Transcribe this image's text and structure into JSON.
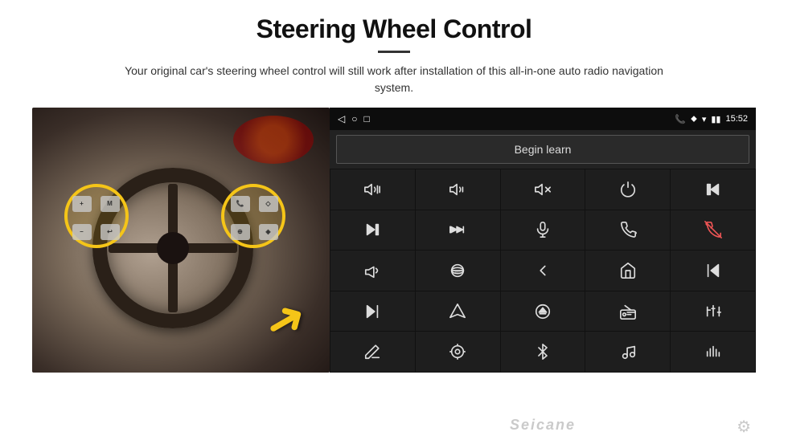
{
  "header": {
    "title": "Steering Wheel Control",
    "divider": true,
    "subtitle": "Your original car's steering wheel control will still work after installation of this all-in-one auto radio navigation system."
  },
  "status_bar": {
    "left_icons": [
      "◁",
      "○",
      "□"
    ],
    "right_icons": [
      "📞",
      "📍",
      "📶"
    ],
    "time": "15:52"
  },
  "begin_learn": {
    "label": "Begin learn"
  },
  "grid": {
    "cells": [
      {
        "icon": "vol-up",
        "label": "Volume Up"
      },
      {
        "icon": "vol-down",
        "label": "Volume Down"
      },
      {
        "icon": "vol-mute",
        "label": "Mute"
      },
      {
        "icon": "power",
        "label": "Power"
      },
      {
        "icon": "prev-track",
        "label": "Previous Track"
      },
      {
        "icon": "next-track",
        "label": "Next Track"
      },
      {
        "icon": "ff-track",
        "label": "Fast Forward"
      },
      {
        "icon": "mic",
        "label": "Microphone"
      },
      {
        "icon": "phone",
        "label": "Phone"
      },
      {
        "icon": "hang-up",
        "label": "Hang Up"
      },
      {
        "icon": "horn",
        "label": "Horn"
      },
      {
        "icon": "360-cam",
        "label": "360 Camera"
      },
      {
        "icon": "back",
        "label": "Back"
      },
      {
        "icon": "home",
        "label": "Home"
      },
      {
        "icon": "skip-back",
        "label": "Skip Back"
      },
      {
        "icon": "skip-fwd",
        "label": "Skip Forward"
      },
      {
        "icon": "nav",
        "label": "Navigation"
      },
      {
        "icon": "eject",
        "label": "Eject"
      },
      {
        "icon": "radio",
        "label": "Radio"
      },
      {
        "icon": "equalizer",
        "label": "Equalizer"
      },
      {
        "icon": "pen",
        "label": "Pen"
      },
      {
        "icon": "settings2",
        "label": "Settings 2"
      },
      {
        "icon": "bluetooth",
        "label": "Bluetooth"
      },
      {
        "icon": "music",
        "label": "Music"
      },
      {
        "icon": "sound-bars",
        "label": "Sound Bars"
      }
    ]
  },
  "watermark": {
    "text": "Seicane"
  },
  "gear_icon": "⚙"
}
